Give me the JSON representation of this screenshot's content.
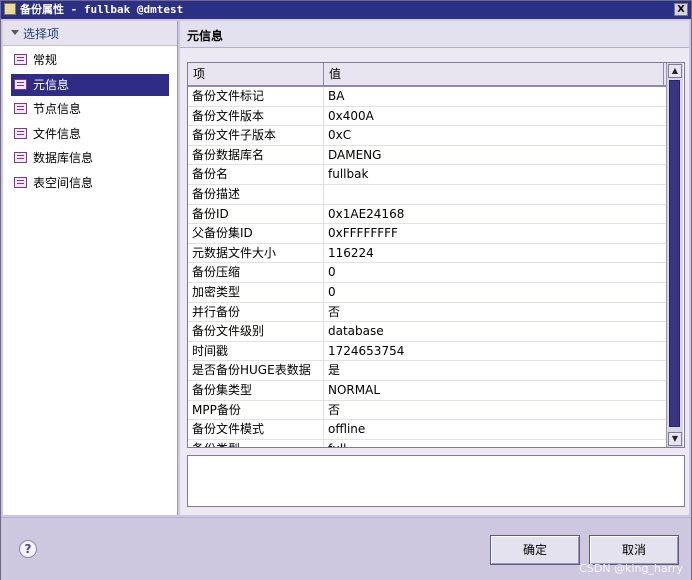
{
  "window": {
    "title": "备份属性 - fullbak @dmtest",
    "close_glyph": "X"
  },
  "nav": {
    "header_label": "选择项",
    "items": [
      {
        "label": "常规",
        "selected": false
      },
      {
        "label": "元信息",
        "selected": true
      },
      {
        "label": "节点信息",
        "selected": false
      },
      {
        "label": "文件信息",
        "selected": false
      },
      {
        "label": "数据库信息",
        "selected": false
      },
      {
        "label": "表空间信息",
        "selected": false
      }
    ]
  },
  "panel": {
    "title": "元信息"
  },
  "table": {
    "headers": [
      "项",
      "值"
    ],
    "rows": [
      [
        "备份文件标记",
        "BA"
      ],
      [
        "备份文件版本",
        "0x400A"
      ],
      [
        "备份文件子版本",
        "0xC"
      ],
      [
        "备份数据库名",
        "DAMENG"
      ],
      [
        "备份名",
        "fullbak"
      ],
      [
        "备份描述",
        ""
      ],
      [
        "备份ID",
        "0x1AE24168"
      ],
      [
        "父备份集ID",
        "0xFFFFFFFF"
      ],
      [
        "元数据文件大小",
        "116224"
      ],
      [
        "备份压缩",
        "0"
      ],
      [
        "加密类型",
        "0"
      ],
      [
        "并行备份",
        "否"
      ],
      [
        "备份文件级别",
        "database"
      ],
      [
        "时间戳",
        "1724653754"
      ],
      [
        "是否备份HUGE表数据",
        "是"
      ],
      [
        "备份集类型",
        "NORMAL"
      ],
      [
        "MPP备份",
        "否"
      ],
      [
        "备份文件模式",
        "offline"
      ],
      [
        "备份类型",
        "full"
      ]
    ]
  },
  "buttons": {
    "ok": "确定",
    "cancel": "取消"
  },
  "help": {
    "glyph": "?"
  },
  "watermark": "CSDN @king_harry"
}
